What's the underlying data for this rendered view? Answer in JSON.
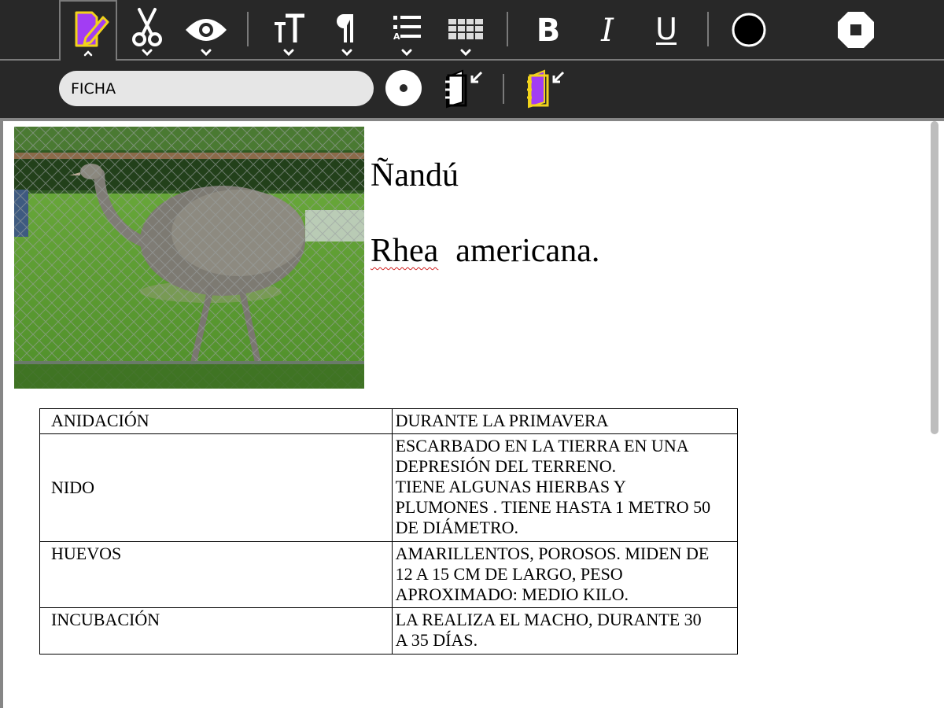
{
  "toolbar": {
    "tools": [
      {
        "name": "activity-tab",
        "icon": "edit-document-icon"
      },
      {
        "name": "edit",
        "icon": "scissors-icon"
      },
      {
        "name": "view",
        "icon": "eye-icon"
      },
      {
        "name": "text",
        "icon": "text-size-icon"
      },
      {
        "name": "paragraph",
        "icon": "pilcrow-icon"
      },
      {
        "name": "list",
        "icon": "numbered-list-icon"
      },
      {
        "name": "table",
        "icon": "table-icon"
      },
      {
        "name": "bold",
        "icon": "bold-icon",
        "label": "B"
      },
      {
        "name": "italic",
        "icon": "italic-icon",
        "label": "I"
      },
      {
        "name": "underline",
        "icon": "underline-icon",
        "label": "U"
      },
      {
        "name": "color",
        "icon": "color-circle-icon"
      },
      {
        "name": "stop",
        "icon": "stop-icon"
      }
    ],
    "accent_color": "#f2d31b",
    "accent_fill": "#a23df3"
  },
  "activity": {
    "title_value": "FICHA",
    "buttons": [
      "share-dot-icon",
      "keep-journal-icon",
      "keep-activity-icon"
    ]
  },
  "document": {
    "title": "Ñandú",
    "subtitle_word1": "Rhea",
    "subtitle_word2": "americana.",
    "image_icon": "rhea-photo",
    "table": {
      "rows": [
        {
          "key": "ANIDACIÓN",
          "value": [
            "DURANTE LA PRIMAVERA"
          ]
        },
        {
          "key": "NIDO",
          "value": [
            "ESCARBADO EN LA  TIERRA EN UNA",
            "DEPRESIÓN DEL TERRENO.",
            "TIENE ALGUNAS HIERBAS Y",
            "PLUMONES . TIENE HASTA 1 METRO 50",
            "DE DIÁMETRO."
          ]
        },
        {
          "key": "HUEVOS",
          "value": [
            "AMARILLENTOS, POROSOS. MIDEN DE",
            "12 A 15 CM DE LARGO, PESO",
            "APROXIMADO: MEDIO KILO."
          ]
        },
        {
          "key": "INCUBACIÓN",
          "value": [
            "LA REALIZA EL MACHO, DURANTE 30",
            "A 35  DÍAS."
          ]
        }
      ]
    }
  }
}
